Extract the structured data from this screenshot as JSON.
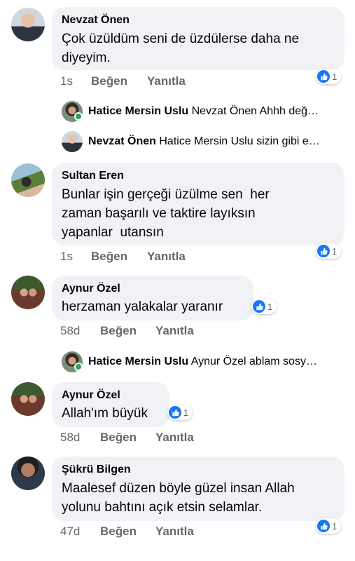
{
  "comments": [
    {
      "name": "Nevzat Önen",
      "text": "Çok üzüldüm seni de üzdülerse daha ne\ndiyeyim.",
      "time": "1s",
      "like": "Beğen",
      "reply": "Yanıtla",
      "reactions": "1",
      "avatar_icon": "profile-photo-icon"
    },
    {
      "name": "Sultan Eren",
      "text": "Bunlar işin gerçeği üzülme sen  her\nzaman başarılı ve taktire layıksın\nyapanlar  utansın",
      "time": "1s",
      "like": "Beğen",
      "reply": "Yanıtla",
      "reactions": "1",
      "avatar_icon": "profile-photo-icon"
    },
    {
      "name": "Aynur Özel",
      "text": "herzaman yalakalar yaranır",
      "time": "58d",
      "like": "Beğen",
      "reply": "Yanıtla",
      "reactions": "1",
      "avatar_icon": "profile-photo-icon"
    },
    {
      "name": "Aynur Özel",
      "text": "Allah'ım büyük",
      "time": "58d",
      "like": "Beğen",
      "reply": "Yanıtla",
      "reactions": "1",
      "avatar_icon": "profile-photo-icon"
    },
    {
      "name": "Şükrü Bilgen",
      "text": "Maalesef düzen böyle güzel insan Allah\nyolunu bahtını açık etsin selamlar.",
      "time": "47d",
      "like": "Beğen",
      "reply": "Yanıtla",
      "reactions": "1",
      "avatar_icon": "profile-photo-icon"
    }
  ],
  "replies": [
    {
      "name": "Hatice Mersin Uslu",
      "text": "Nevzat Önen Ahhh değ…"
    },
    {
      "name": "Nevzat Önen",
      "text": "Hatice Mersin Uslu sizin gibi e…"
    },
    {
      "name": "Hatice Mersin Uslu",
      "text": "Aynur Özel ablam sosy…"
    }
  ],
  "colors": {
    "like_blue": "#1877f2",
    "bubble_bg": "#f0f2f5",
    "meta_gray": "#65676b",
    "online_green": "#31a24c"
  },
  "icons": {
    "reaction": "like-thumb-icon",
    "online": "online-status-dot"
  }
}
